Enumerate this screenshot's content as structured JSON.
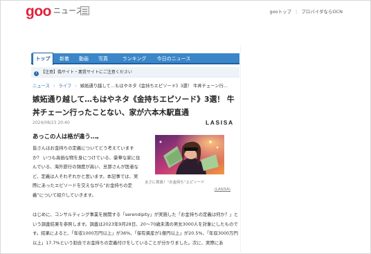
{
  "header": {
    "logo": "goo",
    "logo_sub": "ニュース",
    "links": [
      "gooトップ",
      "プロバイダならOCN"
    ]
  },
  "nav": {
    "items": [
      "トップ",
      "新着",
      "動画",
      "写真",
      "ランキング",
      "今日のニュース"
    ],
    "active_index": 0
  },
  "notice": {
    "text": "【注意】偽サイト・悪質サイトにご注意ください"
  },
  "breadcrumb": {
    "items": [
      "ニュース",
      "ライフ"
    ],
    "current": "嫉妬通り越して…もはやネタ《金持ちエピソード》3選！ 牛丼チェーン行..."
  },
  "article": {
    "title": "嫉妬通り越して…もはやネタ《金持ちエピソード》3選！ 牛丼チェーン行ったことない、家が六本木駅直通",
    "date": "2024/08/23 20:40",
    "brand": "LASISA",
    "lead": "あっこの人は格が違う…。",
    "para1": "皆さんはお金持ちの定義についてどう考えていますか？ いつも高価な物を身につけている、豪華な家に住んでいる、海外旅行の頻度が高い、旦那さんが医者など、定義は人それぞれかと思います。本記事では、実際にあったエピソードを交えながら“お金持ちの定義”について紹介していきます。",
    "caption": "まさに貴族！“お金持ち”エピソード",
    "caption_credit": "(LASISA)",
    "para2": "はじめに、コンサルティング事業を展開する「serendipity」が実施した「お金持ちの定義は何か？」という調査結果を参照します。調査は2023年9月28日、20〜70歳未満の男女3000人を対象にしたものです。結果によると、「年収1000万円以上」が36%、「保有資産が1億円以上」が20.5%、「年収3000万円以上」17.7%という割合でお金持ちの定義付けをしていることが分かりました。次に、実際にあ"
  },
  "colors": {
    "brand_red": "#e0203a",
    "nav_blue": "#3a86c8",
    "link_blue": "#2966b1"
  }
}
